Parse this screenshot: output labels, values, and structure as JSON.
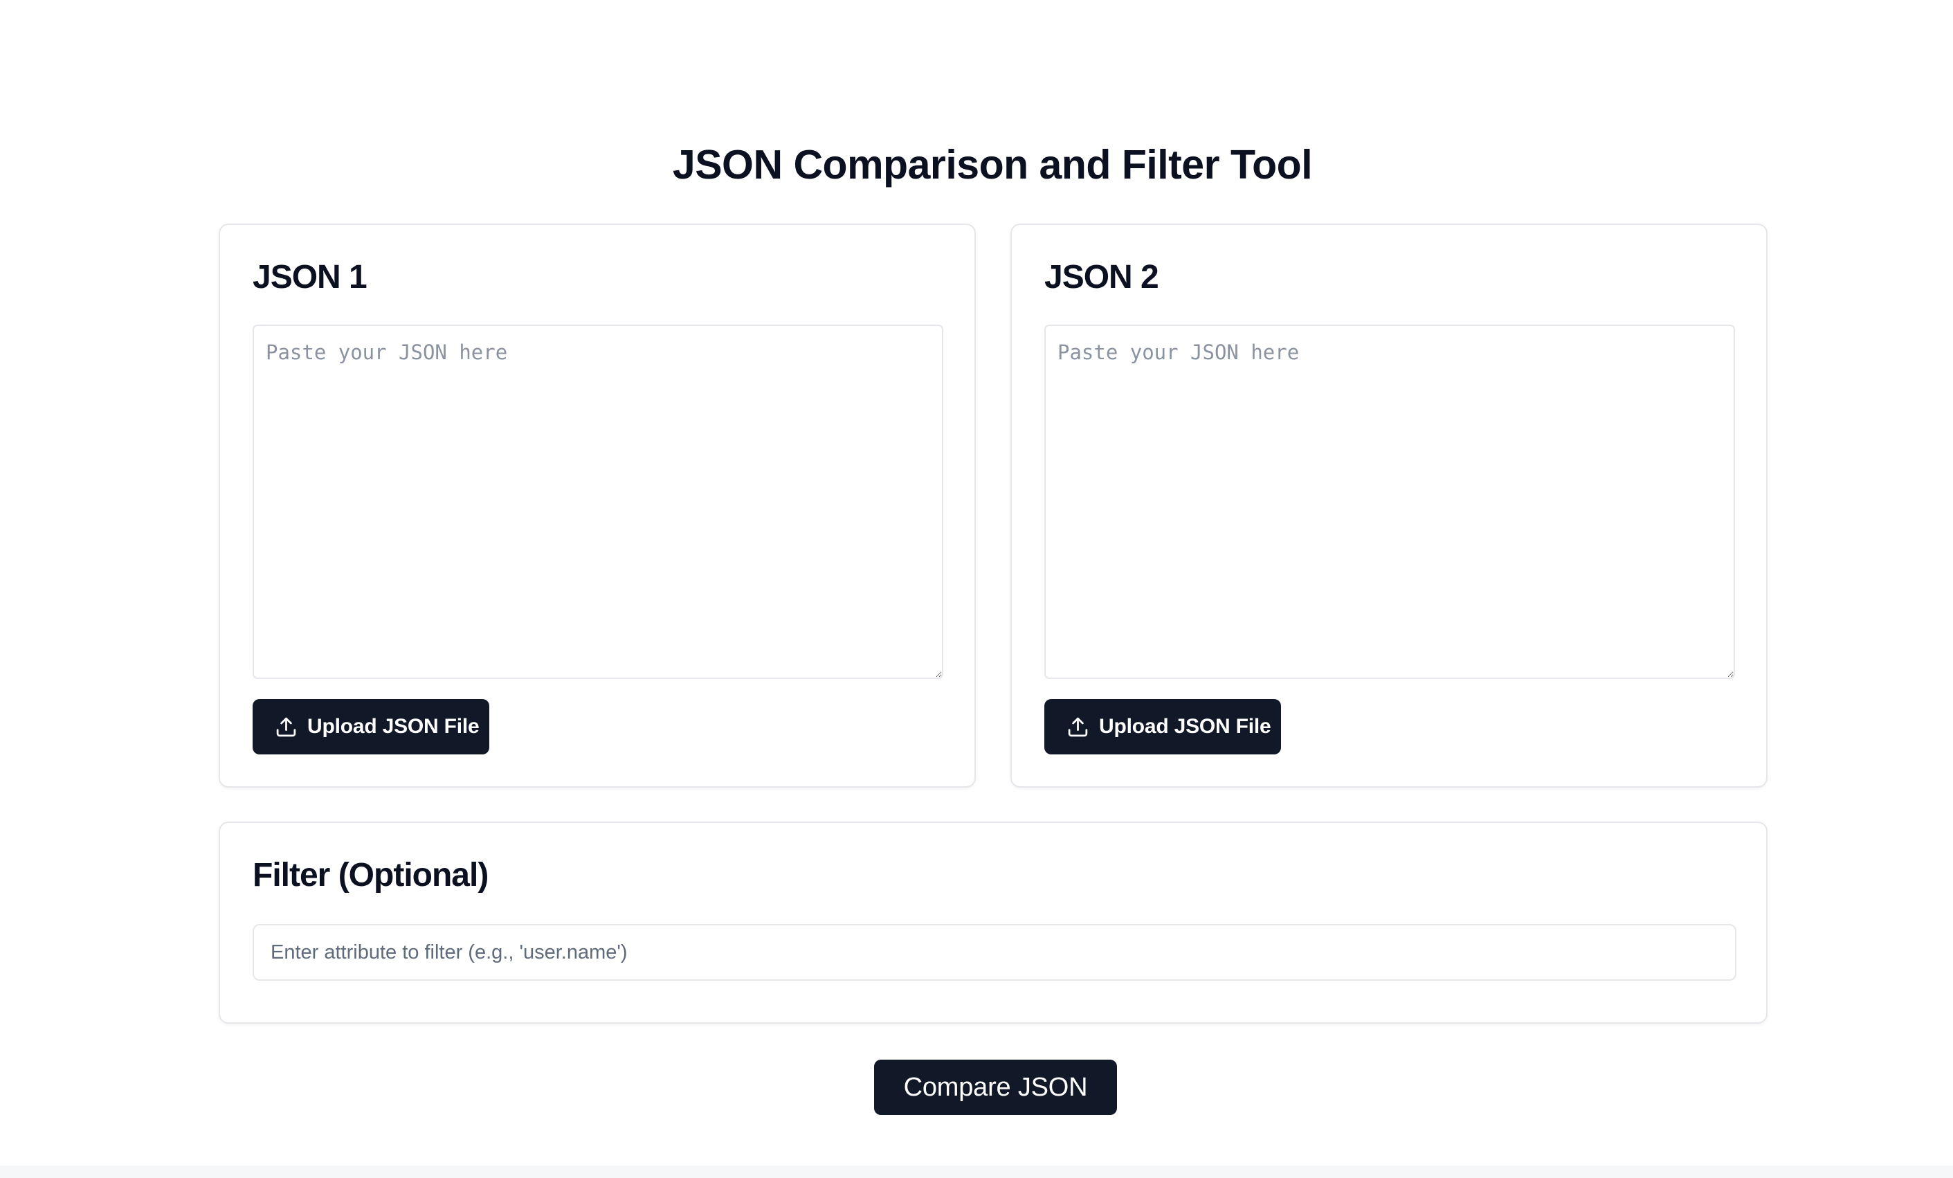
{
  "page": {
    "title": "JSON Comparison and Filter Tool"
  },
  "json1": {
    "heading": "JSON 1",
    "textarea_value": "",
    "textarea_placeholder": "Paste your JSON here",
    "upload_label": "Upload JSON File",
    "upload_icon": "upload-icon"
  },
  "json2": {
    "heading": "JSON 2",
    "textarea_value": "",
    "textarea_placeholder": "Paste your JSON here",
    "upload_label": "Upload JSON File",
    "upload_icon": "upload-icon"
  },
  "filter": {
    "heading": "Filter (Optional)",
    "input_value": "",
    "input_placeholder": "Enter attribute to filter (e.g., 'user.name')"
  },
  "actions": {
    "compare_label": "Compare JSON"
  },
  "colors": {
    "button_background": "#111827",
    "text_primary": "#0b1120",
    "border": "#e5e7eb",
    "placeholder": "#8b93a1"
  }
}
